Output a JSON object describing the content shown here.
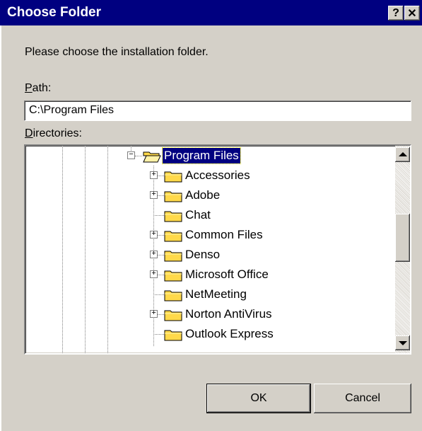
{
  "window": {
    "title": "Choose Folder",
    "help_glyph": "?",
    "close_glyph": "✕"
  },
  "prompt": "Please choose the installation folder.",
  "path": {
    "label_mnemonic": "P",
    "label_rest": "ath:",
    "value": "C:\\Program Files"
  },
  "directories": {
    "label_mnemonic": "D",
    "label_rest": "irectories:",
    "selected": "Program Files",
    "items": [
      {
        "label": "Program Files",
        "expander": "minus",
        "icon": "open-folder-icon"
      },
      {
        "label": "Accessories",
        "expander": "plus",
        "icon": "folder-icon"
      },
      {
        "label": "Adobe",
        "expander": "plus",
        "icon": "folder-icon"
      },
      {
        "label": "Chat",
        "expander": "none",
        "icon": "folder-icon"
      },
      {
        "label": "Common Files",
        "expander": "plus",
        "icon": "folder-icon"
      },
      {
        "label": "Denso",
        "expander": "plus",
        "icon": "folder-icon"
      },
      {
        "label": "Microsoft Office",
        "expander": "plus",
        "icon": "folder-icon"
      },
      {
        "label": "NetMeeting",
        "expander": "none",
        "icon": "folder-icon"
      },
      {
        "label": "Norton AntiVirus",
        "expander": "plus",
        "icon": "folder-icon"
      },
      {
        "label": "Outlook Express",
        "expander": "none",
        "icon": "folder-icon"
      }
    ]
  },
  "buttons": {
    "ok": "OK",
    "cancel": "Cancel"
  },
  "colors": {
    "titlebar": "#000080",
    "face": "#d4d0c8",
    "folder": "#ffd94a",
    "selection": "#000080"
  }
}
